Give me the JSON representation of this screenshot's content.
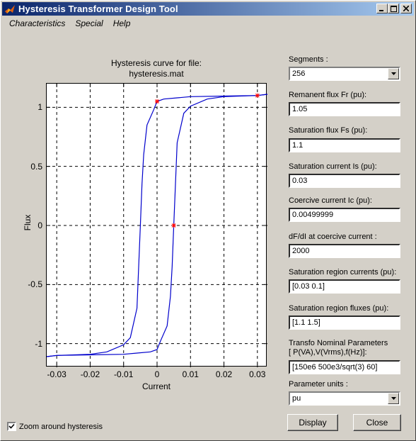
{
  "window": {
    "title": "Hysteresis Transformer Design Tool",
    "controls": [
      "_",
      "□",
      "✕"
    ]
  },
  "menu": {
    "items": [
      "Characteristics",
      "Special",
      "Help"
    ]
  },
  "plot": {
    "title_line1": "Hysteresis curve for file:",
    "title_line2": "hysteresis.mat",
    "xlabel": "Current",
    "ylabel": "Flux"
  },
  "chart_data": {
    "type": "line",
    "title": "Hysteresis curve for file: hysteresis.mat",
    "xlabel": "Current",
    "ylabel": "Flux",
    "xlim": [
      -0.033,
      0.033
    ],
    "ylim": [
      -1.2,
      1.2
    ],
    "xticks": [
      -0.03,
      -0.02,
      -0.01,
      0,
      0.01,
      0.02,
      0.03
    ],
    "xtick_labels": [
      "-0.03",
      "-0.02",
      "-0.01",
      "0",
      "0.01",
      "0.02",
      "0.03"
    ],
    "yticks": [
      -1,
      -0.5,
      0,
      0.5,
      1
    ],
    "ytick_labels": [
      "-1",
      "-0.5",
      "0",
      "0.5",
      "1"
    ],
    "grid": true,
    "line_color": "#0000cc",
    "marker_color": "#ff0000",
    "series": [
      {
        "x": [
          -0.033,
          -0.03,
          -0.02,
          -0.015,
          -0.01,
          -0.008,
          -0.006,
          -0.0055,
          -0.005,
          -0.0045,
          -0.004,
          -0.003,
          -0.001,
          0,
          0.002,
          0.006,
          0.01,
          0.02,
          0.03,
          0.033
        ],
        "y": [
          -1.11,
          -1.1,
          -1.09,
          -1.07,
          -1.01,
          -0.95,
          -0.7,
          -0.35,
          0,
          0.35,
          0.6,
          0.85,
          0.98,
          1.05,
          1.07,
          1.08,
          1.09,
          1.095,
          1.1,
          1.11
        ]
      },
      {
        "x": [
          0.033,
          0.03,
          0.02,
          0.015,
          0.01,
          0.008,
          0.006,
          0.0055,
          0.005,
          0.0045,
          0.004,
          0.003,
          0.001,
          0,
          -0.002,
          -0.006,
          -0.01,
          -0.02,
          -0.03,
          -0.033
        ],
        "y": [
          1.11,
          1.1,
          1.09,
          1.07,
          1.01,
          0.95,
          0.7,
          0.35,
          0,
          -0.35,
          -0.6,
          -0.85,
          -0.98,
          -1.05,
          -1.07,
          -1.08,
          -1.09,
          -1.095,
          -1.1,
          -1.11
        ]
      }
    ],
    "markers": [
      {
        "x": 0,
        "y": 1.05
      },
      {
        "x": 0.005,
        "y": 0
      },
      {
        "x": 0.03,
        "y": 1.1
      }
    ]
  },
  "panel": {
    "segments_label": "Segments :",
    "segments_value": "256",
    "remanent_label": "Remanent flux Fr (pu):",
    "remanent_value": "1.05",
    "saturation_flux_label": "Saturation flux Fs (pu):",
    "saturation_flux_value": "1.1",
    "saturation_current_label": "Saturation current Is (pu):",
    "saturation_current_value": "0.03",
    "coercive_label": "Coercive current Ic (pu):",
    "coercive_value": "0.00499999",
    "dfdi_label": "dF/dI at coercive current :",
    "dfdi_value": "2000",
    "sat_region_currents_label": "Saturation region currents (pu):",
    "sat_region_currents_value": "[0.03 0.1]",
    "sat_region_fluxes_label": "Saturation region fluxes (pu):",
    "sat_region_fluxes_value": "[1.1 1.5]",
    "transfo_label_line1": "Transfo Nominal Parameters",
    "transfo_label_line2": "[ P(VA),V(Vrms),f(Hz)]:",
    "transfo_value": "[150e6  500e3/sqrt(3)  60]",
    "units_label": "Parameter units :",
    "units_value": "pu"
  },
  "buttons": {
    "display": "Display",
    "close": "Close"
  },
  "checkbox": {
    "label": "Zoom around hysteresis",
    "checked": true
  }
}
